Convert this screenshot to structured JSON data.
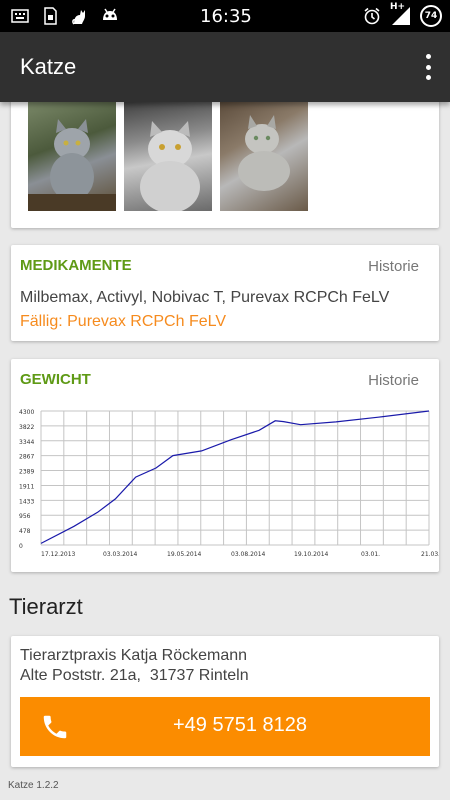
{
  "status_bar": {
    "time": "16:35",
    "network": "H+",
    "battery": "74",
    "left_icons": [
      "keyboard-icon",
      "sim-icon",
      "cat-icon",
      "android-icon"
    ],
    "right_icons": [
      "alarm-icon",
      "signal-icon",
      "battery-icon"
    ]
  },
  "app_bar": {
    "title": "Katze",
    "overflow_icon": "more-vert-icon"
  },
  "photos": {
    "count": 3
  },
  "medications": {
    "title": "MEDIKAMENTE",
    "history_link": "Historie",
    "list": "Milbemax, Activyl, Nobivac T, Purevax RCPCh FeLV",
    "due": "Fällig: Purevax RCPCh FeLV",
    "title_color": "#5f9a16",
    "due_color": "#f68b1e"
  },
  "weight": {
    "title": "GEWICHT",
    "history_link": "Historie"
  },
  "chart_data": {
    "type": "line",
    "title": "",
    "xlabel": "",
    "ylabel": "",
    "y_ticks": [
      "0",
      "478",
      "956",
      "1433",
      "1911",
      "2389",
      "2867",
      "3344",
      "3822",
      "4300"
    ],
    "x_ticks": [
      "17.12.2013",
      "03.03.2014",
      "19.05.2014",
      "03.08.2014",
      "19.10.2014",
      "03.01.",
      "21.03."
    ],
    "ylim": [
      0,
      4300
    ],
    "xlim": [
      "2013-12-17",
      "2015-03-21"
    ],
    "grid": true,
    "line_color": "#1a1aaa",
    "series": [
      {
        "x": [
          "2013-12-17",
          "2014-01-25",
          "2014-02-22",
          "2014-03-15",
          "2014-04-08",
          "2014-05-02",
          "2014-05-22",
          "2014-06-25",
          "2014-07-30",
          "2014-09-01",
          "2014-09-20",
          "2014-09-30",
          "2014-10-20",
          "2014-12-01",
          "2015-01-20",
          "2015-03-21"
        ],
        "y": [
          50,
          600,
          1050,
          1480,
          2180,
          2470,
          2870,
          3020,
          3380,
          3680,
          3985,
          3960,
          3860,
          3950,
          4100,
          4300
        ]
      }
    ]
  },
  "vet": {
    "section_title": "Tierarzt",
    "name": "Tierarztpraxis Katja Röckemann",
    "address": "Alte Poststr. 21a,  31737 Rinteln",
    "phone": "+49 5751 8128",
    "phone_icon": "phone-icon",
    "button_color": "#fb8c00"
  },
  "footer": {
    "version": "Katze 1.2.2"
  }
}
